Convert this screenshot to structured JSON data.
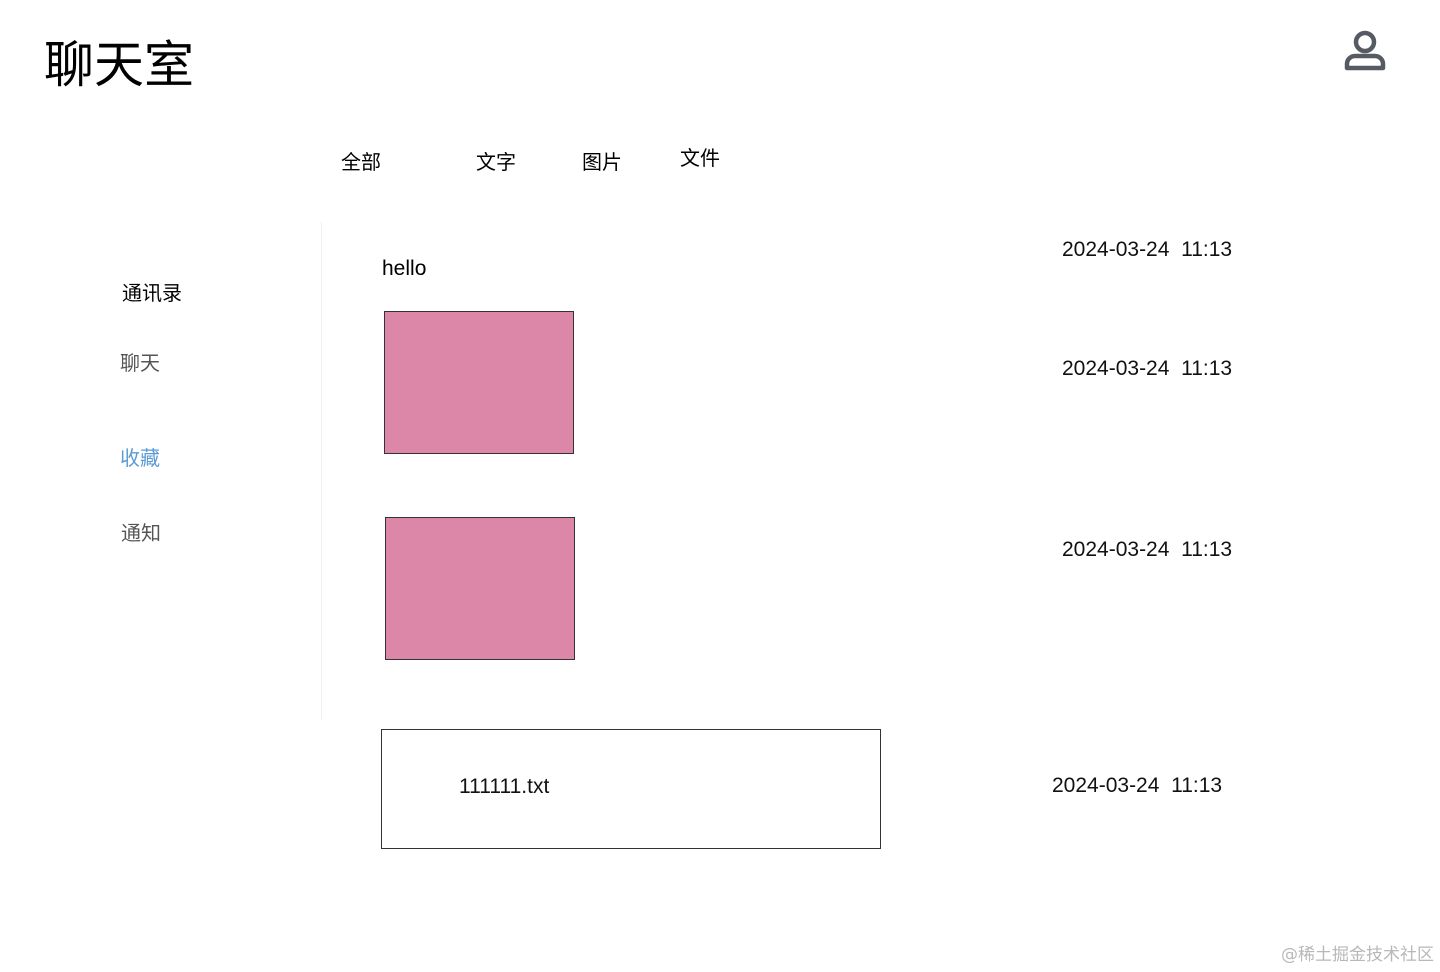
{
  "header": {
    "title": "聊天室",
    "user_icon": "user-icon"
  },
  "tabs": [
    {
      "label": "全部"
    },
    {
      "label": "文字"
    },
    {
      "label": "图片"
    },
    {
      "label": "文件"
    }
  ],
  "sidebar": {
    "items": [
      {
        "label": "通讯录"
      },
      {
        "label": "聊天"
      },
      {
        "label": "收藏",
        "active": true
      },
      {
        "label": "通知"
      }
    ],
    "active_color": "#5b9bd5"
  },
  "messages": [
    {
      "type": "text",
      "content": "hello",
      "time": "2024-03-24  11:13"
    },
    {
      "type": "image",
      "color": "#dc87a8",
      "time": "2024-03-24  11:13"
    },
    {
      "type": "image",
      "color": "#dc87a8",
      "time": "2024-03-24  11:13"
    },
    {
      "type": "file",
      "filename": "111111.txt",
      "time": "2024-03-24  11:13"
    }
  ],
  "watermark": "@稀土掘金技术社区"
}
